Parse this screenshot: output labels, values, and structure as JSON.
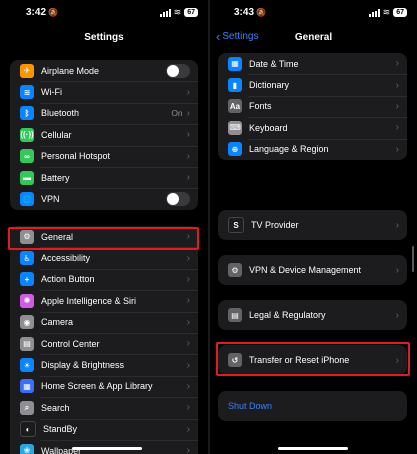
{
  "left": {
    "time": "3:42",
    "battery": "67",
    "title": "Settings",
    "group1": [
      {
        "label": "Airplane Mode",
        "icon": "airplane-icon",
        "glyph": "✈",
        "color": "#ff9500",
        "accessory": "toggle"
      },
      {
        "label": "Wi-Fi",
        "icon": "wifi-icon",
        "glyph": "≋",
        "color": "#0a84ff",
        "accessory": "chevron"
      },
      {
        "label": "Bluetooth",
        "icon": "bluetooth-icon",
        "glyph": "ᛒ",
        "color": "#0a84ff",
        "accessory": "chevron",
        "value": "On"
      },
      {
        "label": "Cellular",
        "icon": "cellular-icon",
        "glyph": "((·))",
        "color": "#34c759",
        "accessory": "chevron"
      },
      {
        "label": "Personal Hotspot",
        "icon": "hotspot-icon",
        "glyph": "∞",
        "color": "#34c759",
        "accessory": "chevron"
      },
      {
        "label": "Battery",
        "icon": "battery-icon",
        "glyph": "▬",
        "color": "#34c759",
        "accessory": "chevron"
      },
      {
        "label": "VPN",
        "icon": "vpn-icon",
        "glyph": "🌐",
        "color": "#0a84ff",
        "accessory": "toggle"
      }
    ],
    "group2": [
      {
        "label": "General",
        "icon": "gear-icon",
        "glyph": "⚙",
        "color": "#8e8e93"
      },
      {
        "label": "Accessibility",
        "icon": "accessibility-icon",
        "glyph": "♿",
        "color": "#0a84ff"
      },
      {
        "label": "Action Button",
        "icon": "action-button-icon",
        "glyph": "+",
        "color": "#0a84ff"
      },
      {
        "label": "Apple Intelligence & Siri",
        "icon": "siri-icon",
        "glyph": "✺",
        "color": "#d05ce3"
      },
      {
        "label": "Camera",
        "icon": "camera-icon",
        "glyph": "◉",
        "color": "#8e8e93"
      },
      {
        "label": "Control Center",
        "icon": "control-center-icon",
        "glyph": "▤",
        "color": "#8e8e93"
      },
      {
        "label": "Display & Brightness",
        "icon": "brightness-icon",
        "glyph": "☀",
        "color": "#0a84ff"
      },
      {
        "label": "Home Screen & App Library",
        "icon": "home-screen-icon",
        "glyph": "▦",
        "color": "#3a6ff7"
      },
      {
        "label": "Search",
        "icon": "search-icon",
        "glyph": "⌕",
        "color": "#8e8e93"
      },
      {
        "label": "StandBy",
        "icon": "standby-icon",
        "glyph": "◐",
        "color": "#1c1c1e"
      },
      {
        "label": "Wallpaper",
        "icon": "wallpaper-icon",
        "glyph": "❀",
        "color": "#2aa9e0"
      }
    ]
  },
  "right": {
    "time": "3:43",
    "battery": "67",
    "back_label": "Settings",
    "title": "General",
    "group1": [
      {
        "label": "Date & Time",
        "icon": "calendar-icon",
        "glyph": "▦",
        "color": "#0a84ff"
      },
      {
        "label": "Dictionary",
        "icon": "dictionary-icon",
        "glyph": "▮",
        "color": "#0a84ff"
      },
      {
        "label": "Fonts",
        "icon": "fonts-icon",
        "glyph": "Aa",
        "color": "#636366"
      },
      {
        "label": "Keyboard",
        "icon": "keyboard-icon",
        "glyph": "⌨",
        "color": "#8e8e93"
      },
      {
        "label": "Language & Region",
        "icon": "globe-icon",
        "glyph": "⊕",
        "color": "#0a84ff"
      }
    ],
    "tv_provider": {
      "label": "TV Provider",
      "icon": "tv-provider-icon",
      "glyph": "S",
      "color": "#1c1c1e"
    },
    "vpn_device": {
      "label": "VPN & Device Management",
      "icon": "gear-icon",
      "glyph": "⚙",
      "color": "#636366"
    },
    "legal": {
      "label": "Legal & Regulatory",
      "icon": "legal-icon",
      "glyph": "▤",
      "color": "#636366"
    },
    "transfer": {
      "label": "Transfer or Reset iPhone",
      "icon": "reset-icon",
      "glyph": "↺",
      "color": "#636366"
    },
    "shutdown_label": "Shut Down"
  }
}
